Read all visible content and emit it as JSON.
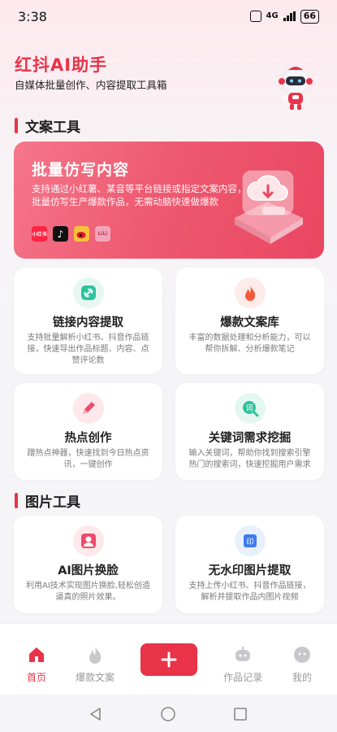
{
  "status_bar": {
    "time": "3:38",
    "network": "4G",
    "battery": "66"
  },
  "header": {
    "title": "红抖AI助手",
    "subtitle": "自媒体批量创作、内容提取工具箱"
  },
  "sections": {
    "copy_tools": "文案工具",
    "image_tools": "图片工具"
  },
  "banner": {
    "title": "批量仿写内容",
    "description": "支持通过小红薯、某音等平台链接或指定文案内容，批量仿写生产爆款作品，无需动脑快速做爆款",
    "platforms": [
      "小红书",
      "抖音",
      "微博",
      "LiLi"
    ]
  },
  "cards": [
    {
      "title": "链接内容提取",
      "desc": "支持批量解析小红书、抖音作品链接，快速导出作品标题、内容、点赞评论数",
      "icon": "link-icon"
    },
    {
      "title": "爆款文案库",
      "desc": "丰富的数据处理和分析能力，可以帮你拆解、分析爆款笔记",
      "icon": "fire-icon"
    },
    {
      "title": "热点创作",
      "desc": "蹭热点神器，快速找到今日热点资讯，一键创作",
      "icon": "pencil-icon"
    },
    {
      "title": "关键词需求挖掘",
      "desc": "输入关键词，帮助你找到搜索引擎热门的搜索词，快速挖掘用户需求",
      "icon": "keyword-search-icon"
    },
    {
      "title": "AI图片换脸",
      "desc": "利用AI技术实现图片换脸,轻松创造逼真的照片效果。",
      "icon": "face-swap-icon"
    },
    {
      "title": "无水印图片提取",
      "desc": "支持上传小红书、抖音作品链接，解析并提取作品内图片视频",
      "icon": "watermark-icon"
    }
  ],
  "tabs": {
    "home": "首页",
    "hot_copy": "爆款文案",
    "records": "作品记录",
    "mine": "我的"
  },
  "colors": {
    "accent": "#e83348",
    "banner_start": "#f5768a",
    "banner_end": "#ea4661"
  }
}
